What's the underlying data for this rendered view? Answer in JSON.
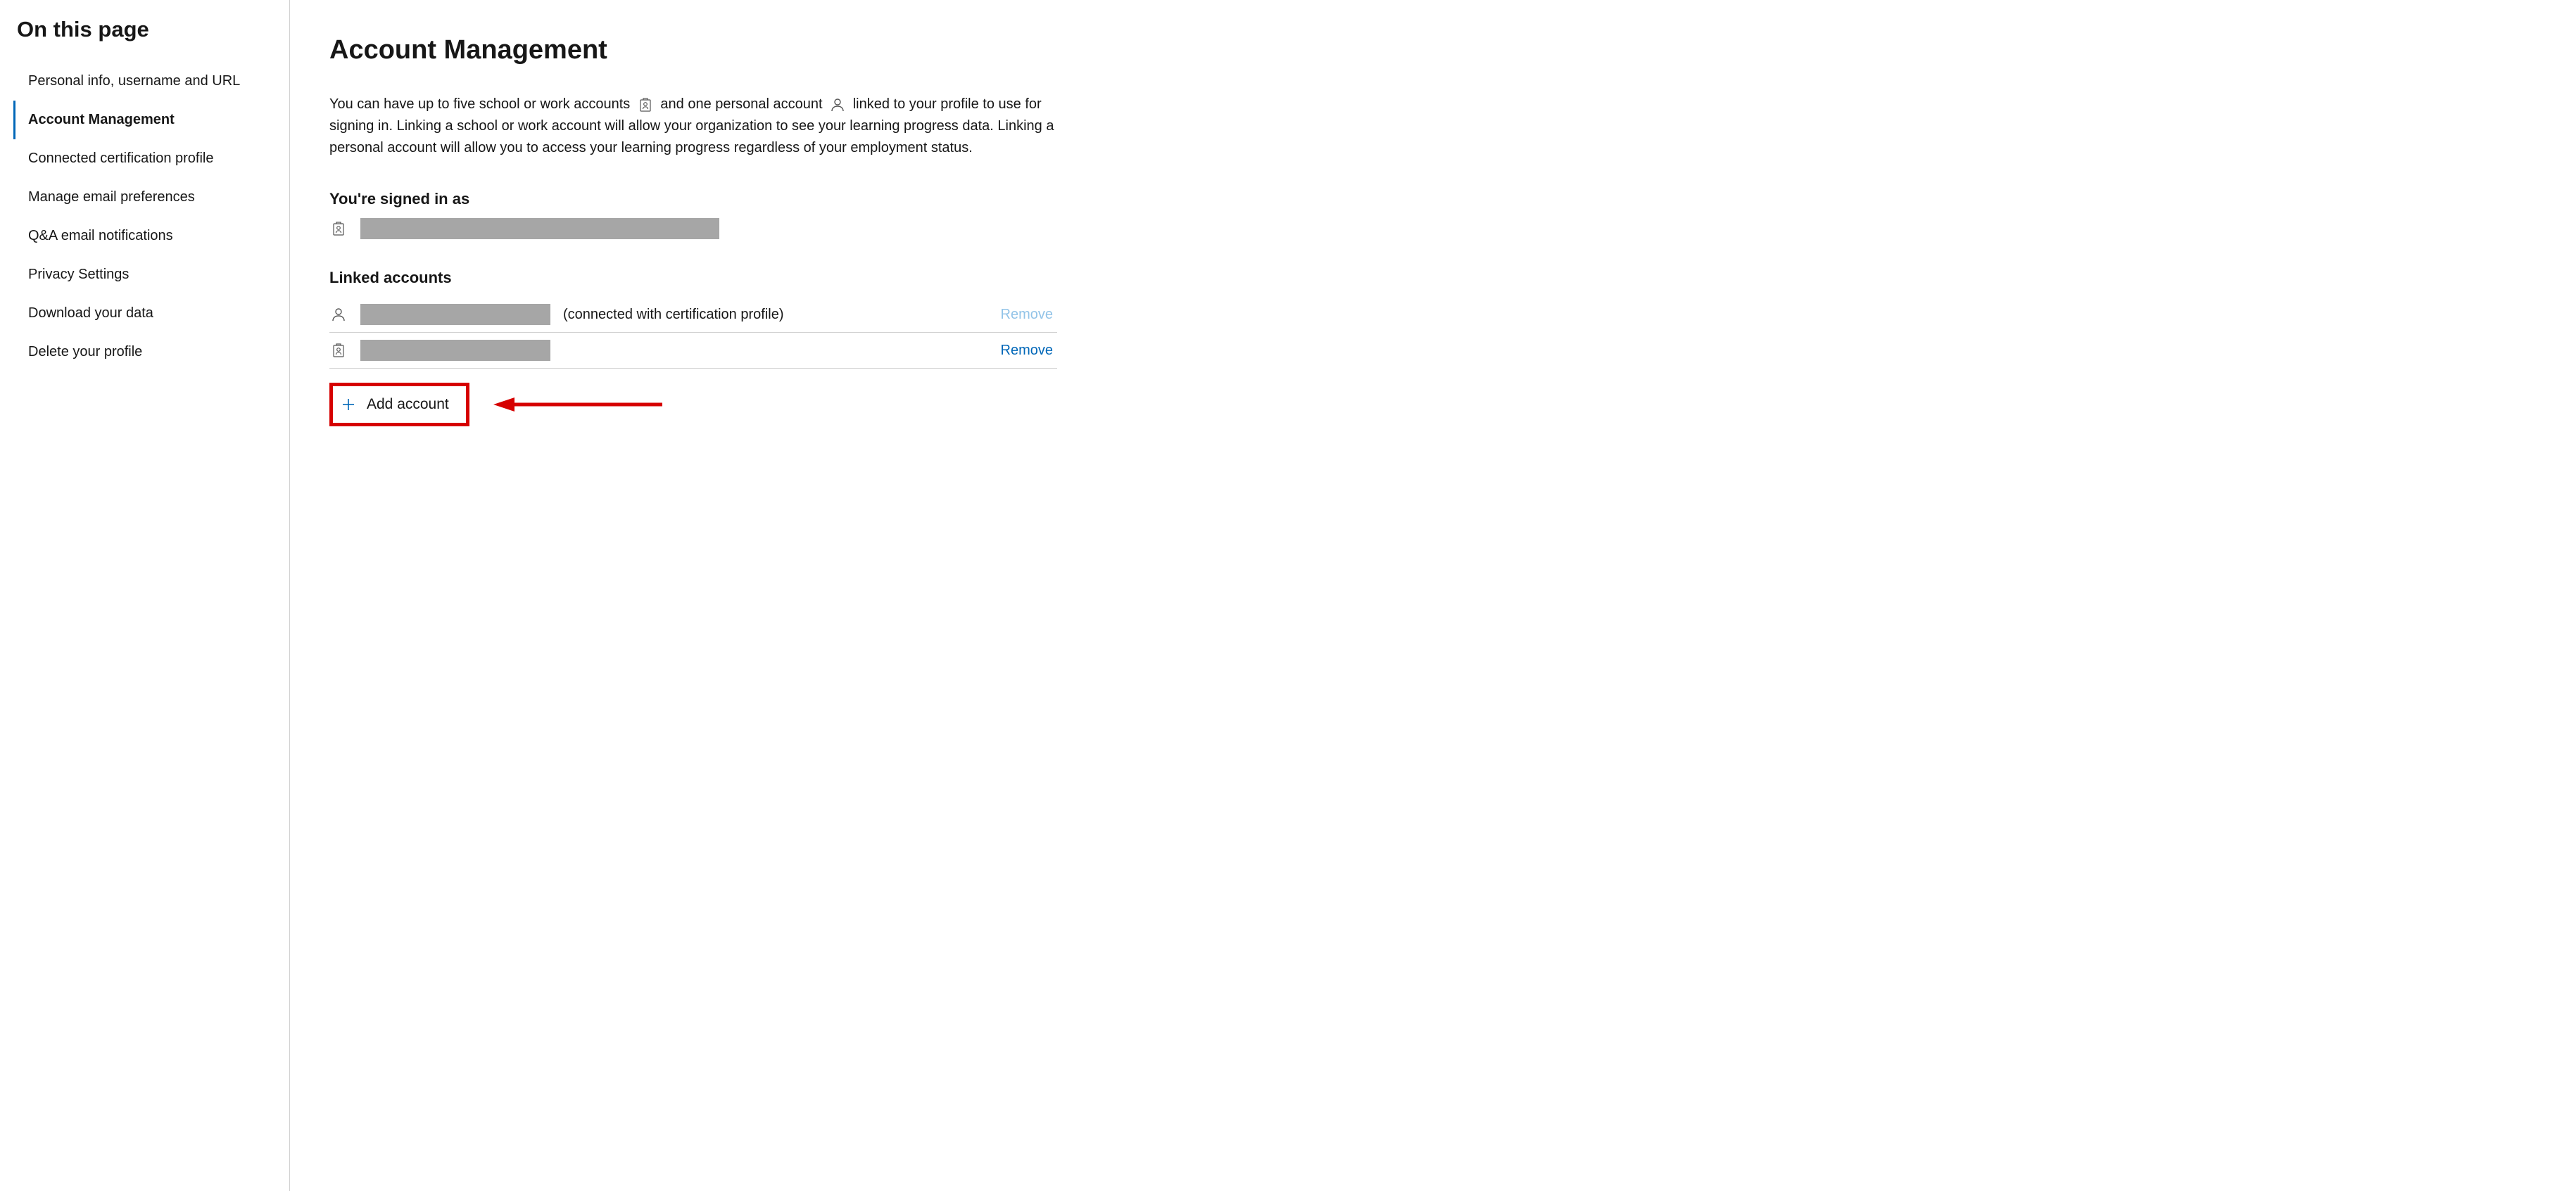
{
  "sidebar": {
    "title": "On this page",
    "items": [
      {
        "label": "Personal info, username and URL",
        "active": false
      },
      {
        "label": "Account Management",
        "active": true
      },
      {
        "label": "Connected certification profile",
        "active": false
      },
      {
        "label": "Manage email preferences",
        "active": false
      },
      {
        "label": "Q&A email notifications",
        "active": false
      },
      {
        "label": "Privacy Settings",
        "active": false
      },
      {
        "label": "Download your data",
        "active": false
      },
      {
        "label": "Delete your profile",
        "active": false
      }
    ]
  },
  "main": {
    "title": "Account Management",
    "description_part1": "You can have up to five school or work accounts",
    "description_part2": "and one personal account",
    "description_part3": "linked to your profile to use for signing in. Linking a school or work account will allow your organization to see your learning progress data. Linking a personal account will allow you to access your learning progress regardless of your employment status.",
    "signed_in_heading": "You're signed in as",
    "linked_heading": "Linked accounts",
    "linked": [
      {
        "icon": "person",
        "note": "(connected with certification profile)",
        "remove": "Remove",
        "remove_disabled": true
      },
      {
        "icon": "badge",
        "note": "",
        "remove": "Remove",
        "remove_disabled": false
      }
    ],
    "add_account": "Add account"
  }
}
